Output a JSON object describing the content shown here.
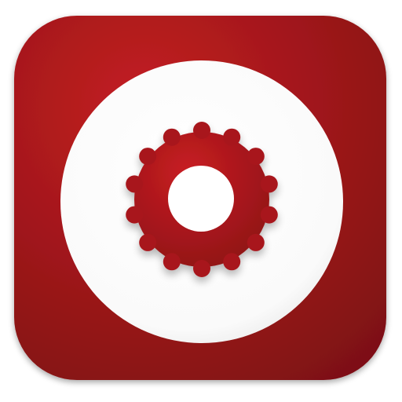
{
  "app_icon": {
    "icon": "gear-icon",
    "colors": {
      "tile_light": "#C41E22",
      "tile_dark": "#7E1113",
      "disc": "#FFFFFF",
      "disc_shadow": "#E6E6E6",
      "gear_light": "#C81D22",
      "gear_dark": "#8C1216",
      "hole": "#FFFFFF"
    }
  }
}
